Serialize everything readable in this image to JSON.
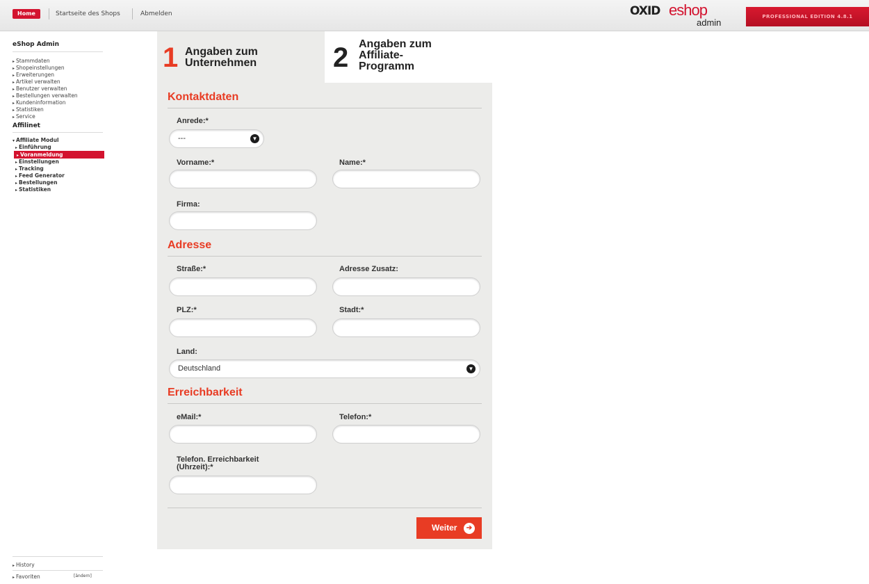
{
  "topbar": {
    "home": "Home",
    "shop_start": "Startseite des Shops",
    "logout": "Abmelden",
    "logo_oxid": "OXID",
    "logo_eshop": "eshop",
    "logo_admin": "admin",
    "edition": "PROFESSIONAL EDITION 4.8.1",
    "accent": "#d3132f"
  },
  "sidebar": {
    "title": "eShop Admin",
    "items": [
      "Stammdaten",
      "Shopeinstellungen",
      "Erweiterungen",
      "Artikel verwalten",
      "Benutzer verwalten",
      "Bestellungen verwalten",
      "Kundeninformation",
      "Statistiken",
      "Service"
    ],
    "affilinet_title": "Affilinet",
    "module": "Affiliate Modul",
    "module_items": [
      "Einführung",
      "Voranmeldung",
      "Einstellungen",
      "Tracking",
      "Feed Generator",
      "Bestellungen",
      "Statistiken"
    ],
    "history": "History",
    "favorites": "Favoriten",
    "favorites_change": "[ändern]"
  },
  "steps": {
    "step1_num": "1",
    "step1_label_1": "Angaben zum",
    "step1_label_2": "Unternehmen",
    "step2_num": "2",
    "step2_label_1": "Angaben zum",
    "step2_label_2": "Affiliate-",
    "step2_label_3": "Programm",
    "active_color": "#e83c24"
  },
  "form": {
    "section_contact": "Kontaktdaten",
    "anrede_label": "Anrede:*",
    "anrede_value": "---",
    "vorname_label": "Vorname:*",
    "vorname_value": "",
    "name_label": "Name:*",
    "name_value": "",
    "firma_label": "Firma:",
    "firma_value": "",
    "section_address": "Adresse",
    "strasse_label": "Straße:*",
    "strasse_value": "",
    "adresse_zusatz_label": "Adresse Zusatz:",
    "adresse_zusatz_value": "",
    "plz_label": "PLZ:*",
    "plz_value": "",
    "stadt_label": "Stadt:*",
    "stadt_value": "",
    "land_label": "Land:",
    "land_value": "Deutschland",
    "section_reach": "Erreichbarkeit",
    "email_label": "eMail:*",
    "email_value": "",
    "telefon_label": "Telefon:*",
    "telefon_value": "",
    "erreichbarkeit_label_1": "Telefon. Erreichbarkeit",
    "erreichbarkeit_label_2": "(Uhrzeit):*",
    "erreichbarkeit_value": "",
    "submit": "Weiter"
  }
}
